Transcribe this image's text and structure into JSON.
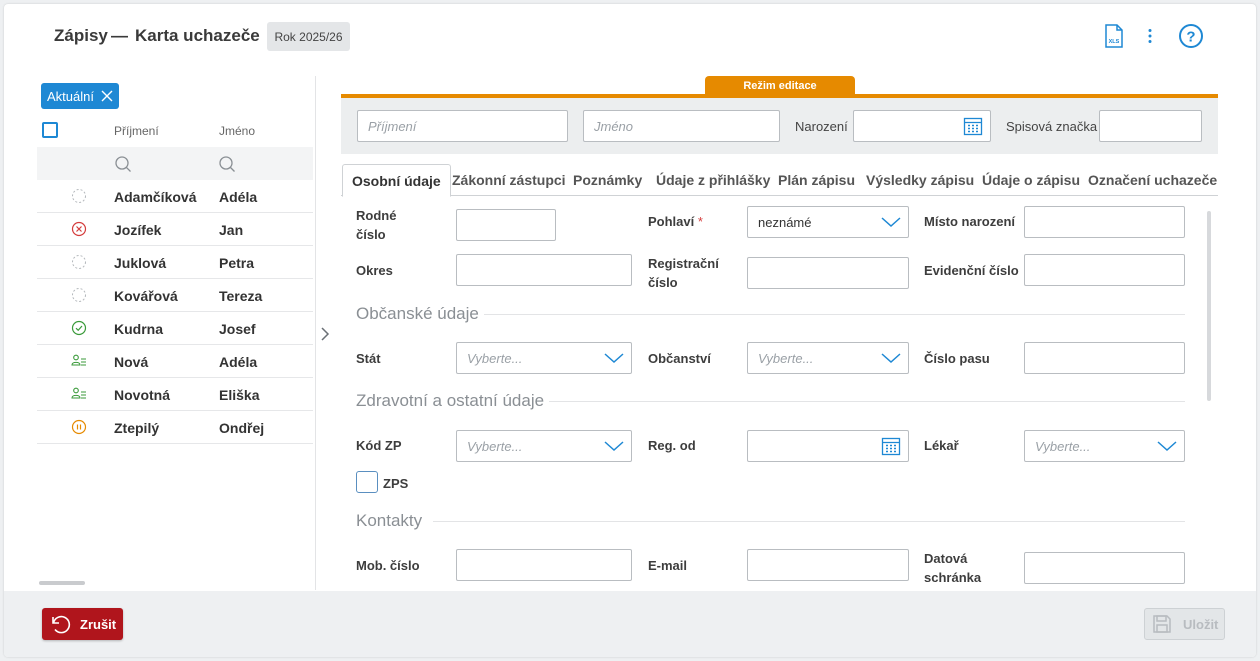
{
  "header": {
    "title": "Zápisy",
    "dash": "—",
    "subtitle": "Karta uchazeče",
    "year": "Rok 2025/26"
  },
  "filter": {
    "chip_label": "Aktuální"
  },
  "list": {
    "col_surname": "Příjmení",
    "col_name": "Jméno",
    "rows": [
      {
        "surname": "Adamčíková",
        "name": "Adéla",
        "status": "dashed-circle-icon"
      },
      {
        "surname": "Jozífek",
        "name": "Jan",
        "status": "cancelled-icon"
      },
      {
        "surname": "Juklová",
        "name": "Petra",
        "status": "dashed-circle-icon"
      },
      {
        "surname": "Kovářová",
        "name": "Tereza",
        "status": "dashed-circle-icon"
      },
      {
        "surname": "Kudrna",
        "name": "Josef",
        "status": "check-circle-icon"
      },
      {
        "surname": "Nová",
        "name": "Adéla",
        "status": "enrolled-person-icon"
      },
      {
        "surname": "Novotná",
        "name": "Eliška",
        "status": "enrolled-person-icon"
      },
      {
        "surname": "Ztepilý",
        "name": "Ondřej",
        "status": "paused-icon"
      }
    ]
  },
  "editor": {
    "mode_label": "Režim editace",
    "search": {
      "surname_placeholder": "Příjmení",
      "name_placeholder": "Jméno",
      "birth_label": "Narození",
      "file_label": "Spisová značka"
    },
    "tabs": [
      "Osobní údaje",
      "Zákonní zástupci",
      "Poznámky",
      "Údaje z přihlášky",
      "Plán zápisu",
      "Výsledky zápisu",
      "Údaje o zápisu",
      "Označení uchazeče"
    ],
    "fields": {
      "birth_number": "Rodné číslo",
      "gender": "Pohlaví",
      "gender_required": "*",
      "gender_value": "neznámé",
      "birthplace": "Místo narození",
      "district": "Okres",
      "registration_number": "Registrační číslo",
      "record_number": "Evidenční číslo",
      "civic_section": "Občanské údaje",
      "country": "Stát",
      "citizenship": "Občanství",
      "passport": "Číslo pasu",
      "select_placeholder": "Vyberte...",
      "health_section": "Zdravotní a ostatní údaje",
      "insurance_code": "Kód ZP",
      "registered_from": "Reg. od",
      "doctor": "Lékař",
      "zps": "ZPS",
      "contacts_section": "Kontakty",
      "mobile": "Mob. číslo",
      "email": "E-mail",
      "databox": "Datová schránka"
    }
  },
  "footer": {
    "cancel_label": "Zrušit",
    "save_label": "Uložit"
  },
  "colors": {
    "accent_blue": "#1e88d4",
    "edit_orange": "#e68a00",
    "cancel_red": "#b0151c"
  }
}
